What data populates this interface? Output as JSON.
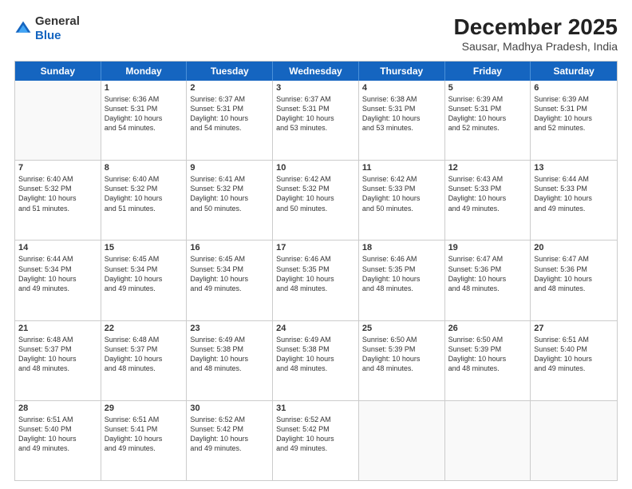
{
  "header": {
    "logo_line1": "General",
    "logo_line2": "Blue",
    "title": "December 2025",
    "subtitle": "Sausar, Madhya Pradesh, India"
  },
  "days_of_week": [
    "Sunday",
    "Monday",
    "Tuesday",
    "Wednesday",
    "Thursday",
    "Friday",
    "Saturday"
  ],
  "weeks": [
    [
      {
        "day": "",
        "empty": true
      },
      {
        "day": "1",
        "sunrise": "Sunrise: 6:36 AM",
        "sunset": "Sunset: 5:31 PM",
        "daylight": "Daylight: 10 hours and 54 minutes."
      },
      {
        "day": "2",
        "sunrise": "Sunrise: 6:37 AM",
        "sunset": "Sunset: 5:31 PM",
        "daylight": "Daylight: 10 hours and 54 minutes."
      },
      {
        "day": "3",
        "sunrise": "Sunrise: 6:37 AM",
        "sunset": "Sunset: 5:31 PM",
        "daylight": "Daylight: 10 hours and 53 minutes."
      },
      {
        "day": "4",
        "sunrise": "Sunrise: 6:38 AM",
        "sunset": "Sunset: 5:31 PM",
        "daylight": "Daylight: 10 hours and 53 minutes."
      },
      {
        "day": "5",
        "sunrise": "Sunrise: 6:39 AM",
        "sunset": "Sunset: 5:31 PM",
        "daylight": "Daylight: 10 hours and 52 minutes."
      },
      {
        "day": "6",
        "sunrise": "Sunrise: 6:39 AM",
        "sunset": "Sunset: 5:31 PM",
        "daylight": "Daylight: 10 hours and 52 minutes."
      }
    ],
    [
      {
        "day": "7",
        "sunrise": "Sunrise: 6:40 AM",
        "sunset": "Sunset: 5:32 PM",
        "daylight": "Daylight: 10 hours and 51 minutes."
      },
      {
        "day": "8",
        "sunrise": "Sunrise: 6:40 AM",
        "sunset": "Sunset: 5:32 PM",
        "daylight": "Daylight: 10 hours and 51 minutes."
      },
      {
        "day": "9",
        "sunrise": "Sunrise: 6:41 AM",
        "sunset": "Sunset: 5:32 PM",
        "daylight": "Daylight: 10 hours and 50 minutes."
      },
      {
        "day": "10",
        "sunrise": "Sunrise: 6:42 AM",
        "sunset": "Sunset: 5:32 PM",
        "daylight": "Daylight: 10 hours and 50 minutes."
      },
      {
        "day": "11",
        "sunrise": "Sunrise: 6:42 AM",
        "sunset": "Sunset: 5:33 PM",
        "daylight": "Daylight: 10 hours and 50 minutes."
      },
      {
        "day": "12",
        "sunrise": "Sunrise: 6:43 AM",
        "sunset": "Sunset: 5:33 PM",
        "daylight": "Daylight: 10 hours and 49 minutes."
      },
      {
        "day": "13",
        "sunrise": "Sunrise: 6:44 AM",
        "sunset": "Sunset: 5:33 PM",
        "daylight": "Daylight: 10 hours and 49 minutes."
      }
    ],
    [
      {
        "day": "14",
        "sunrise": "Sunrise: 6:44 AM",
        "sunset": "Sunset: 5:34 PM",
        "daylight": "Daylight: 10 hours and 49 minutes."
      },
      {
        "day": "15",
        "sunrise": "Sunrise: 6:45 AM",
        "sunset": "Sunset: 5:34 PM",
        "daylight": "Daylight: 10 hours and 49 minutes."
      },
      {
        "day": "16",
        "sunrise": "Sunrise: 6:45 AM",
        "sunset": "Sunset: 5:34 PM",
        "daylight": "Daylight: 10 hours and 49 minutes."
      },
      {
        "day": "17",
        "sunrise": "Sunrise: 6:46 AM",
        "sunset": "Sunset: 5:35 PM",
        "daylight": "Daylight: 10 hours and 48 minutes."
      },
      {
        "day": "18",
        "sunrise": "Sunrise: 6:46 AM",
        "sunset": "Sunset: 5:35 PM",
        "daylight": "Daylight: 10 hours and 48 minutes."
      },
      {
        "day": "19",
        "sunrise": "Sunrise: 6:47 AM",
        "sunset": "Sunset: 5:36 PM",
        "daylight": "Daylight: 10 hours and 48 minutes."
      },
      {
        "day": "20",
        "sunrise": "Sunrise: 6:47 AM",
        "sunset": "Sunset: 5:36 PM",
        "daylight": "Daylight: 10 hours and 48 minutes."
      }
    ],
    [
      {
        "day": "21",
        "sunrise": "Sunrise: 6:48 AM",
        "sunset": "Sunset: 5:37 PM",
        "daylight": "Daylight: 10 hours and 48 minutes."
      },
      {
        "day": "22",
        "sunrise": "Sunrise: 6:48 AM",
        "sunset": "Sunset: 5:37 PM",
        "daylight": "Daylight: 10 hours and 48 minutes."
      },
      {
        "day": "23",
        "sunrise": "Sunrise: 6:49 AM",
        "sunset": "Sunset: 5:38 PM",
        "daylight": "Daylight: 10 hours and 48 minutes."
      },
      {
        "day": "24",
        "sunrise": "Sunrise: 6:49 AM",
        "sunset": "Sunset: 5:38 PM",
        "daylight": "Daylight: 10 hours and 48 minutes."
      },
      {
        "day": "25",
        "sunrise": "Sunrise: 6:50 AM",
        "sunset": "Sunset: 5:39 PM",
        "daylight": "Daylight: 10 hours and 48 minutes."
      },
      {
        "day": "26",
        "sunrise": "Sunrise: 6:50 AM",
        "sunset": "Sunset: 5:39 PM",
        "daylight": "Daylight: 10 hours and 48 minutes."
      },
      {
        "day": "27",
        "sunrise": "Sunrise: 6:51 AM",
        "sunset": "Sunset: 5:40 PM",
        "daylight": "Daylight: 10 hours and 49 minutes."
      }
    ],
    [
      {
        "day": "28",
        "sunrise": "Sunrise: 6:51 AM",
        "sunset": "Sunset: 5:40 PM",
        "daylight": "Daylight: 10 hours and 49 minutes."
      },
      {
        "day": "29",
        "sunrise": "Sunrise: 6:51 AM",
        "sunset": "Sunset: 5:41 PM",
        "daylight": "Daylight: 10 hours and 49 minutes."
      },
      {
        "day": "30",
        "sunrise": "Sunrise: 6:52 AM",
        "sunset": "Sunset: 5:42 PM",
        "daylight": "Daylight: 10 hours and 49 minutes."
      },
      {
        "day": "31",
        "sunrise": "Sunrise: 6:52 AM",
        "sunset": "Sunset: 5:42 PM",
        "daylight": "Daylight: 10 hours and 49 minutes."
      },
      {
        "day": "",
        "empty": true
      },
      {
        "day": "",
        "empty": true
      },
      {
        "day": "",
        "empty": true
      }
    ]
  ]
}
